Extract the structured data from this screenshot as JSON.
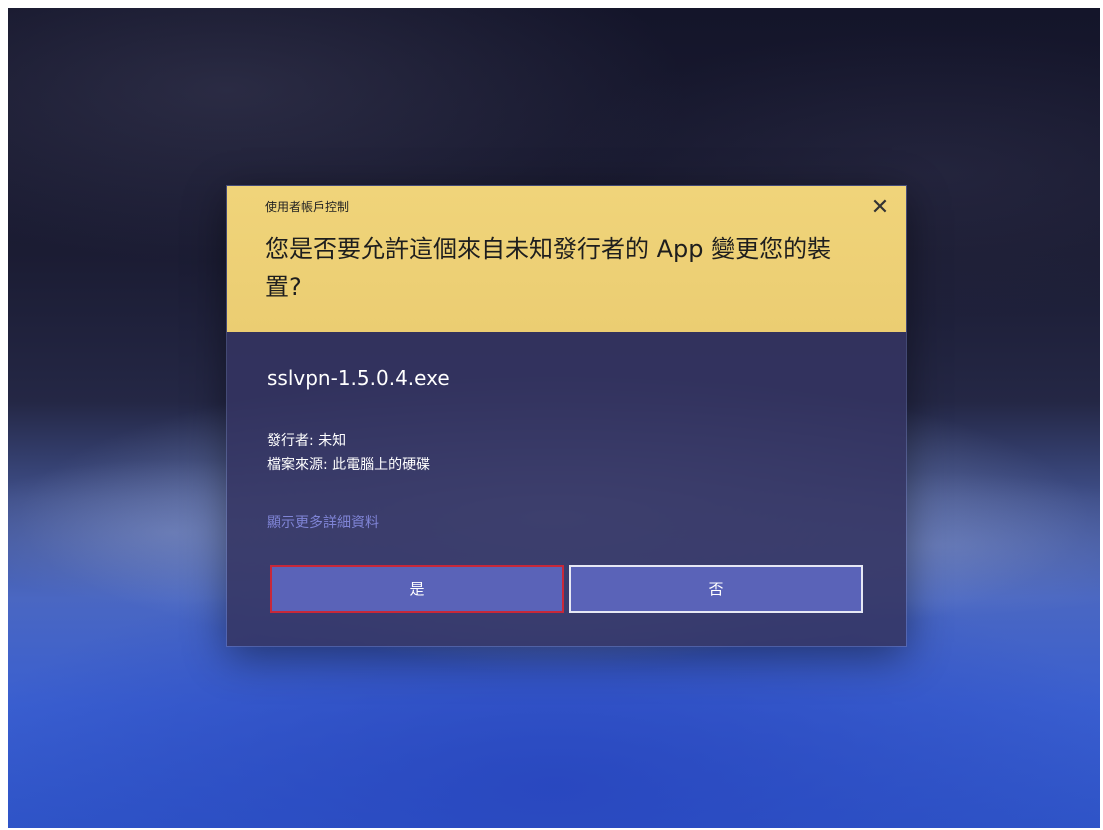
{
  "dialog": {
    "caption": "使用者帳戶控制",
    "question": "您是否要允許這個來自未知發行者的 App 變更您的裝置?",
    "close_icon": "close-icon",
    "close_glyph": "✕",
    "filename": "sslvpn-1.5.0.4.exe",
    "publisher": "發行者: 未知",
    "origin": "檔案來源: 此電腦上的硬碟",
    "more_details": "顯示更多詳細資料",
    "yes_label": "是",
    "no_label": "否"
  },
  "colors": {
    "header_bg": "#ebcd72",
    "body_bg": "#343462",
    "button_bg": "#5a63b8",
    "yes_highlight_border": "#c7283a",
    "link": "#7f84d6"
  }
}
